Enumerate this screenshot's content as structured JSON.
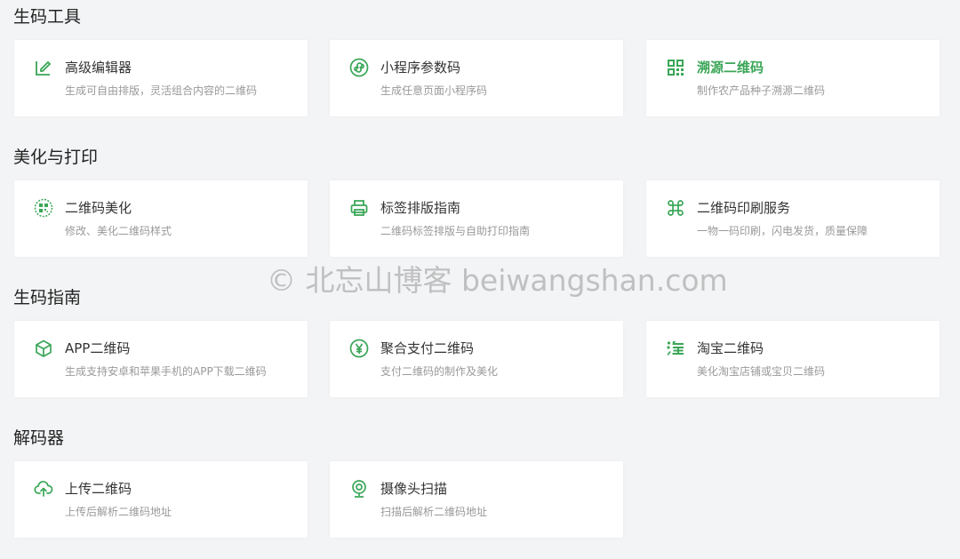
{
  "sections": [
    {
      "title": "生码工具",
      "items": [
        {
          "icon": "edit-icon",
          "title": "高级编辑器",
          "desc": "生成可自由排版，灵活组合内容的二维码"
        },
        {
          "icon": "mini-program-icon",
          "title": "小程序参数码",
          "desc": "生成任意页面小程序码"
        },
        {
          "icon": "qr-grid-icon",
          "title": "溯源二维码",
          "desc": "制作农产品种子溯源二维码"
        }
      ]
    },
    {
      "title": "美化与打印",
      "items": [
        {
          "icon": "qr-beautify-icon",
          "title": "二维码美化",
          "desc": "修改、美化二维码样式"
        },
        {
          "icon": "printer-icon",
          "title": "标签排版指南",
          "desc": "二维码标签排版与自助打印指南"
        },
        {
          "icon": "cloverleaf-icon",
          "title": "二维码印刷服务",
          "desc": "一物一码印刷，闪电发货，质量保障"
        }
      ]
    },
    {
      "title": "生码指南",
      "items": [
        {
          "icon": "cube-icon",
          "title": "APP二维码",
          "desc": "生成支持安卓和苹果手机的APP下载二维码"
        },
        {
          "icon": "yuan-icon",
          "title": "聚合支付二维码",
          "desc": "支付二维码的制作及美化"
        },
        {
          "icon": "taobao-icon",
          "title": "淘宝二维码",
          "desc": "美化淘宝店铺或宝贝二维码"
        }
      ]
    },
    {
      "title": "解码器",
      "items": [
        {
          "icon": "cloud-upload-icon",
          "title": "上传二维码",
          "desc": "上传后解析二维码地址"
        },
        {
          "icon": "camera-icon",
          "title": "摄像头扫描",
          "desc": "扫描后解析二维码地址"
        }
      ]
    }
  ],
  "watermark": "© 北忘山博客 beiwangshan.com",
  "colors": {
    "accent": "#3aa657",
    "background": "#f3f4f5",
    "card": "#ffffff"
  }
}
